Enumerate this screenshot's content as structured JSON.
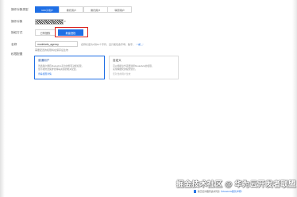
{
  "form": {
    "target_type_label": "操作对象类型",
    "target_types": [
      {
        "label": "IAM子用户",
        "active": true
      },
      {
        "label": "委托用户",
        "active": false
      },
      {
        "label": "委托用户",
        "active": false
      },
      {
        "label": "联邦用户",
        "active": false
      }
    ],
    "target_label": "操作对象",
    "target_dropdown_icon": "chevron-down-icon",
    "auth_label": "授权方式",
    "auth_modes": [
      {
        "label": "已有授权",
        "active": false
      },
      {
        "label": "新建授权",
        "active": true
      }
    ],
    "name_label": "名称",
    "name_value": "modelarts_agency",
    "name_hint": "名称长度为1到64个字符，且只能包含字母、数字、",
    "name_hint_link": "“-”或“_”",
    "name_hint2": "需要配置的权限将在保存后生效",
    "permission_label": "权限配置",
    "cards": [
      {
        "title": "普通用户",
        "desc_1": "普通用户拥有ModelArts平台的所有功能权限，",
        "desc_2": "但不能修改集群管理等资源的相关配置。",
        "link": "查看权限详情"
      },
      {
        "title": "自定义",
        "desc_1": "可以根据业务需要选择ModelArts的权限，",
        "desc_2": "实现精细化的权限管控。",
        "note": "仅对当前用户生效"
      }
    ]
  },
  "footer": {
    "agree_text": "我已经详细阅读并同意",
    "agree_link": "《ModelArts服务声明》"
  },
  "watermark": "掘金技术社区 @ 华为云开发者联盟",
  "colors": {
    "primary": "#1f6fe5",
    "highlight": "#d9201c"
  }
}
